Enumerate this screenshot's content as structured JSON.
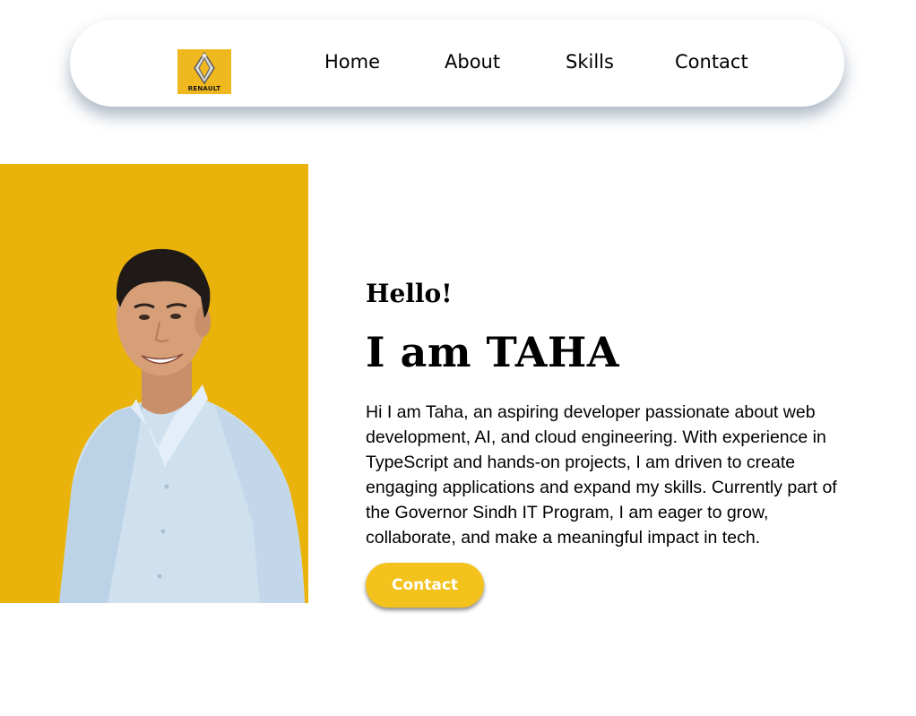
{
  "navbar": {
    "logo_text": "RENAULT",
    "links": [
      "Home",
      "About",
      "Skills",
      "Contact"
    ]
  },
  "hero": {
    "greeting": "Hello!",
    "headline": "I am TAHA",
    "bio": "Hi I am Taha, an aspiring developer passionate about web development, AI, and cloud engineering. With experience in TypeScript and hands-on projects, I am driven to create engaging applications and expand my skills. Currently part of the Governor Sindh IT Program, I am eager to grow, collaborate, and make a meaningful impact in tech.",
    "button_label": "Contact"
  },
  "colors": {
    "accent": "#efb81f",
    "photo_background": "#e9b30c",
    "button": "#f3c21c",
    "text": "#000000"
  },
  "icons": {
    "logo": "renault-diamond-logo",
    "photo": "profile-photo"
  }
}
